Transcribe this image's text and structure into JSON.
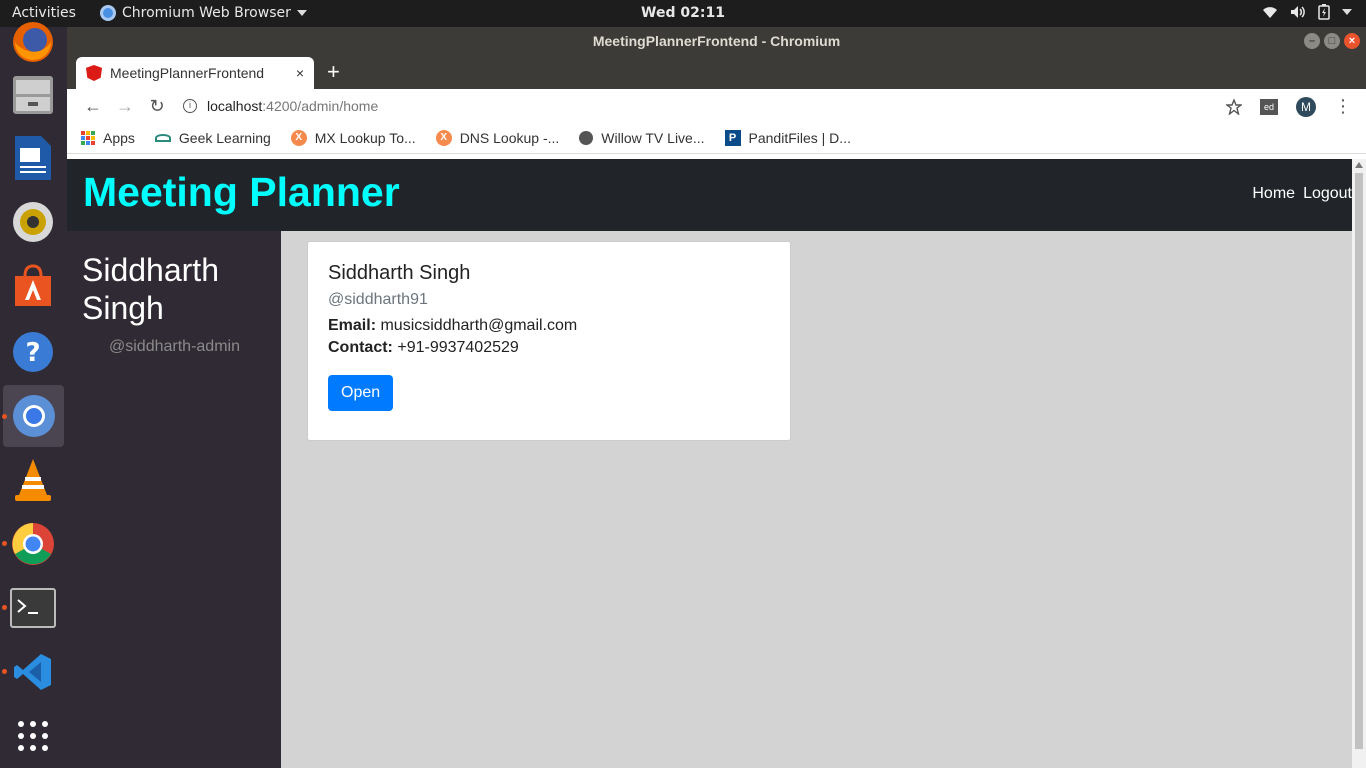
{
  "topbar": {
    "activities": "Activities",
    "app_menu": "Chromium Web Browser",
    "clock": "Wed 02:11"
  },
  "window": {
    "title": "MeetingPlannerFrontend - Chromium"
  },
  "tabs": [
    {
      "label": "MeetingPlannerFrontend",
      "close": "×"
    }
  ],
  "new_tab": "+",
  "omnibox": {
    "host": "localhost",
    "rest": ":4200/admin/home",
    "info_glyph": "i",
    "ext_label": "ed",
    "profile_initial": "M"
  },
  "bookmarks": [
    {
      "label": "Apps",
      "icon": "apps-grid-icon"
    },
    {
      "label": "Geek Learning",
      "icon": "geek-learning-icon"
    },
    {
      "label": "MX Lookup To...",
      "icon": "mx-lookup-icon"
    },
    {
      "label": "DNS Lookup -...",
      "icon": "dns-lookup-icon"
    },
    {
      "label": "Willow TV Live...",
      "icon": "globe-icon"
    },
    {
      "label": "PanditFiles | D...",
      "icon": "panditfiles-icon"
    }
  ],
  "app": {
    "brand": "Meeting Planner",
    "nav": {
      "home": "Home",
      "logout": "Logout"
    },
    "sidebar": {
      "name": "Siddharth Singh",
      "handle": "@siddharth-admin"
    },
    "card": {
      "name": "Siddharth Singh",
      "username": "@siddharth91",
      "email_label": "Email:",
      "email": "musicsiddharth@gmail.com",
      "contact_label": "Contact:",
      "contact": "+91-9937402529",
      "button": "Open"
    }
  },
  "colors": {
    "brand": "#00ffff",
    "navbar": "#212529",
    "sidebar": "#2f2a33",
    "page_bg": "#d3d3d3",
    "primary_button": "#007bff"
  }
}
